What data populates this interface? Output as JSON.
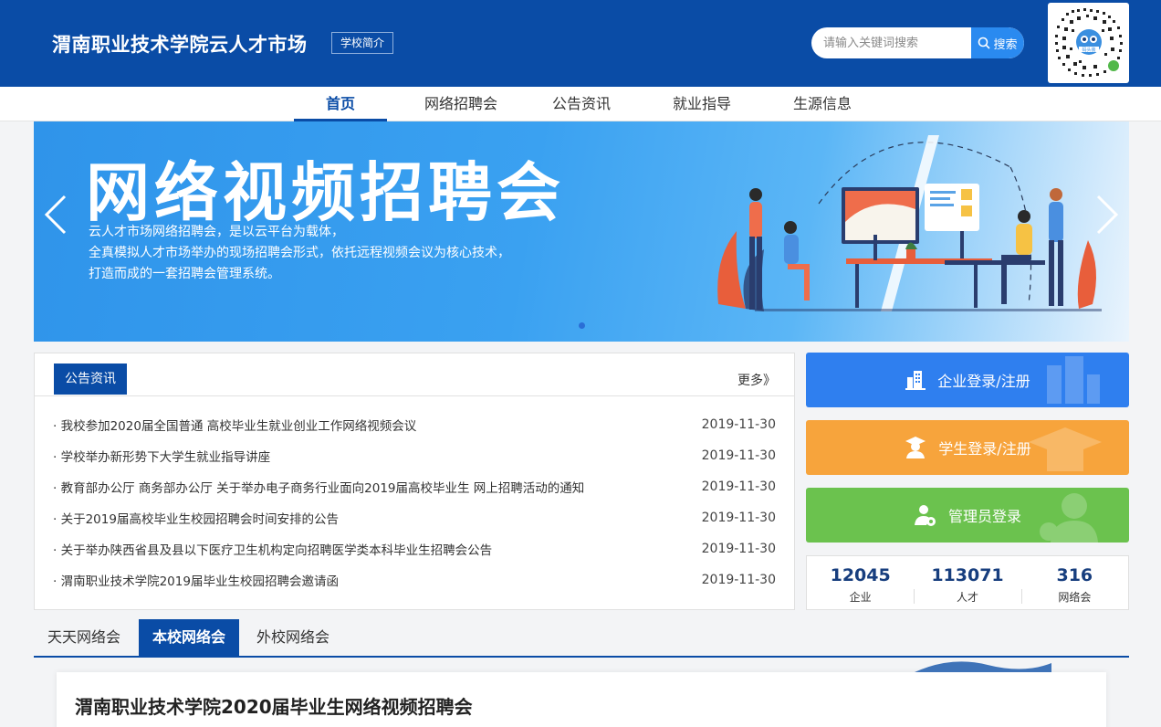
{
  "header": {
    "title": "渭南职业技术学院云人才市场",
    "school_intro": "学校简介",
    "search_placeholder": "请输入关键词搜索",
    "search_button": "搜索",
    "qr_label": "码头装"
  },
  "nav": {
    "items": [
      "首页",
      "网络招聘会",
      "公告资讯",
      "就业指导",
      "生源信息"
    ],
    "active": "首页"
  },
  "banner": {
    "title": "网络视频招聘会",
    "desc": [
      "云人才市场网络招聘会，是以云平台为载体，",
      "全真模拟人才市场举办的现场招聘会形式，依托远程视频会议为核心技术，",
      "打造而成的一套招聘会管理系统。"
    ]
  },
  "notice": {
    "tab": "公告资讯",
    "more": "更多》",
    "items": [
      {
        "title": "· 我校参加2020届全国普通 高校毕业生就业创业工作网络视频会议",
        "date": "2019-11-30"
      },
      {
        "title": "· 学校举办新形势下大学生就业指导讲座",
        "date": "2019-11-30"
      },
      {
        "title": "· 教育部办公厅 商务部办公厅 关于举办电子商务行业面向2019届高校毕业生 网上招聘活动的通知",
        "date": "2019-11-30"
      },
      {
        "title": "· 关于2019届高校毕业生校园招聘会时间安排的公告",
        "date": "2019-11-30"
      },
      {
        "title": "· 关于举办陕西省县及县以下医疗卫生机构定向招聘医学类本科毕业生招聘会公告",
        "date": "2019-11-30"
      },
      {
        "title": "· 渭南职业技术学院2019届毕业生校园招聘会邀请函",
        "date": "2019-11-30"
      }
    ]
  },
  "login": {
    "company": "企业登录/注册",
    "student": "学生登录/注册",
    "admin": "管理员登录"
  },
  "stats": [
    {
      "value": "12045",
      "label": "企业"
    },
    {
      "value": "113071",
      "label": "人才"
    },
    {
      "value": "316",
      "label": "网络会"
    }
  ],
  "tabs": [
    "天天网络会",
    "本校网络会",
    "外校网络会"
  ],
  "card": {
    "title": "渭南职业技术学院2020届毕业生网络视频招聘会"
  },
  "colors": {
    "primary": "#0a4ca6",
    "company_btn": "#2f7fef",
    "student_btn": "#f7a43c",
    "admin_btn": "#6bc24e"
  }
}
